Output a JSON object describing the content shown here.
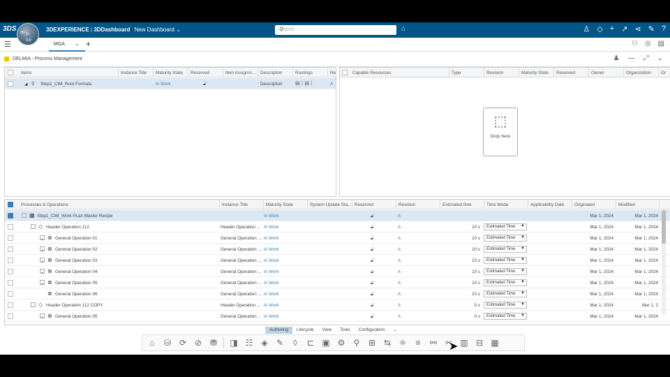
{
  "topbar": {
    "logo": "3DS",
    "compass_top": "3D",
    "compass_v": "V,R",
    "brand": "3DEXPERIENCE",
    "separator": " | ",
    "app": "3DDashboard",
    "dashboard": "New Dashboard",
    "search_placeholder": "Search"
  },
  "tab": {
    "label": "MGA"
  },
  "widget": {
    "title": "DELMIA - Process Management"
  },
  "items_panel": {
    "headers": [
      "Items",
      "Instance Title",
      "Maturity State",
      "Reserved",
      "Item Assignm...",
      "Description",
      "Routings",
      "Re"
    ],
    "row": {
      "name": "Step1_CIM_Root Formula",
      "maturity": "In Work",
      "description": "Description",
      "re": "A"
    }
  },
  "capable_panel": {
    "headers": [
      "Capable Resources",
      "Type",
      "Revision",
      "Maturity State",
      "Reserved",
      "Owner",
      "Organization",
      "Or"
    ],
    "drop_label": "Drop here"
  },
  "process_panel": {
    "headers": [
      "Processes & Operations",
      "Instance Title",
      "Maturity State",
      "System Update Sta...",
      "Reserved",
      "Revision",
      "Estimated time",
      "Time Mode",
      "Applicability Date",
      "Originated",
      "Modified"
    ],
    "rows": [
      {
        "name": "Step1_CIM_Work PLan Master Recipe",
        "title": "",
        "maturity": "In Work",
        "revision": "A",
        "est": "",
        "mode": "",
        "originated": "Mar 1, 2024",
        "modified": "Mar 1, 2024"
      },
      {
        "name": "Header Operation 112",
        "title": "Header Operation ...",
        "maturity": "In Work",
        "revision": "A",
        "est": "10 s",
        "mode": "Estimated Time",
        "originated": "Mar 1, 2024",
        "modified": "Mar 1, 2024"
      },
      {
        "name": "General Operation 01",
        "title": "General Operation ...",
        "maturity": "In Work",
        "revision": "A",
        "est": "10 s",
        "mode": "Estimated Time",
        "originated": "Mar 1, 2024",
        "modified": "Mar 1, 2024"
      },
      {
        "name": "General Operation 02",
        "title": "General Operation ...",
        "maturity": "In Work",
        "revision": "A",
        "est": "10 s",
        "mode": "Estimated Time",
        "originated": "Mar 1, 2024",
        "modified": "Mar 1, 2024"
      },
      {
        "name": "General Operation 03",
        "title": "General Operation ...",
        "maturity": "In Work",
        "revision": "A",
        "est": "10 s",
        "mode": "Estimated Time",
        "originated": "Mar 1, 2024",
        "modified": "Mar 1, 2024"
      },
      {
        "name": "General Operation 04",
        "title": "General Operation ...",
        "maturity": "In Work",
        "revision": "A",
        "est": "10 s",
        "mode": "Estimated Time",
        "originated": "Mar 1, 2024",
        "modified": "Mar 1, 2024"
      },
      {
        "name": "General Operation 05",
        "title": "General Operation ...",
        "maturity": "In Work",
        "revision": "A",
        "est": "10 s",
        "mode": "Estimated Time",
        "originated": "Mar 1, 2024",
        "modified": "Mar 1, 2024"
      },
      {
        "name": "General Operation 06",
        "title": "General Operation ...",
        "maturity": "In Work",
        "revision": "A",
        "est": "10 s",
        "mode": "Estimated Time",
        "originated": "Mar 1, 2024",
        "modified": "Mar 1, 2024"
      },
      {
        "name": "Header Operation 112 COPY",
        "title": "Header Operation ...",
        "maturity": "In Work",
        "revision": "A",
        "est": "0 s",
        "mode": "Estimated Time",
        "originated": "Mar 1, 2024",
        "modified": "Mar 1, 2"
      },
      {
        "name": "General Operation 05",
        "title": "General Operation ...",
        "maturity": "In Work",
        "revision": "A",
        "est": "0 s",
        "mode": "Estimated Time",
        "originated": "Mar 1, 2024",
        "modified": "Mar 1, 2024"
      }
    ]
  },
  "bottom_tabs": [
    "Authoring",
    "Lifecycle",
    "View",
    "Tools",
    "Configuration"
  ],
  "colors": {
    "topbar": "#005686",
    "accent": "#3d7fb0",
    "selection": "#dbe8f4",
    "widget_icon": "#f5c400"
  }
}
